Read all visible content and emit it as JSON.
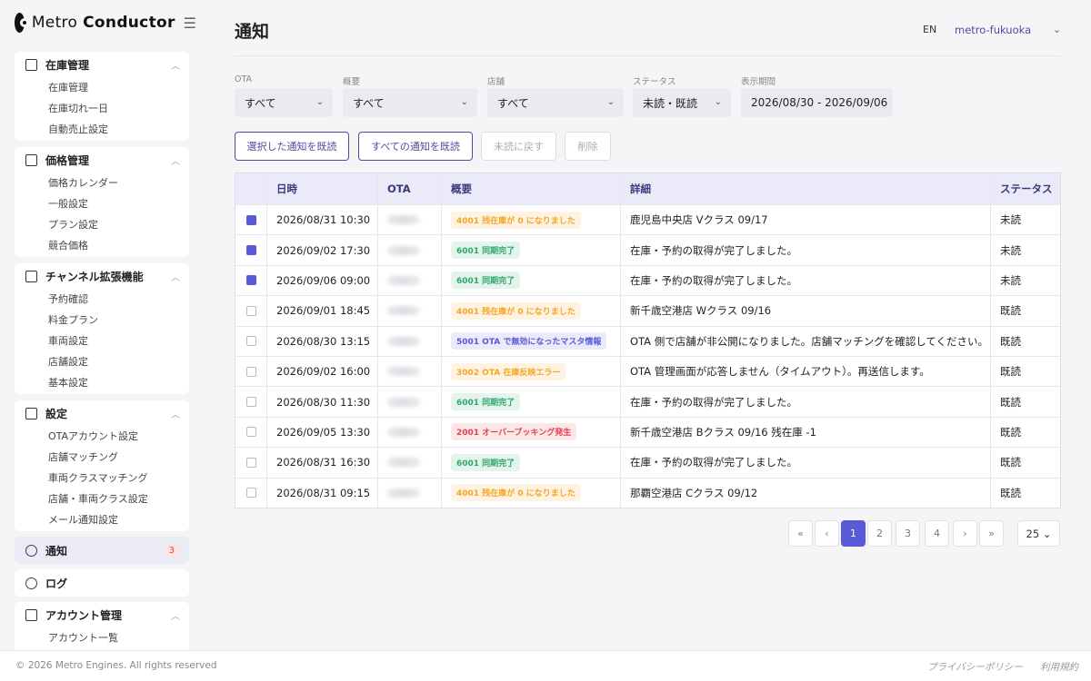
{
  "brand": {
    "name_light": "Metro",
    "name_bold": "Conductor"
  },
  "sidebar": {
    "sections": [
      {
        "title": "在庫管理",
        "items": [
          "在庫管理",
          "在庫切れ一日",
          "自動売止設定"
        ]
      },
      {
        "title": "価格管理",
        "items": [
          "価格カレンダー",
          "一般設定",
          "プラン設定",
          "競合価格"
        ]
      },
      {
        "title": "チャンネル拡張機能",
        "items": [
          "予約確認",
          "料金プラン",
          "車両設定",
          "店舗設定",
          "基本設定"
        ]
      },
      {
        "title": "設定",
        "items": [
          "OTAアカウント設定",
          "店舗マッチング",
          "車両クラスマッチング",
          "店舗・車両クラス設定",
          "メール通知設定"
        ]
      }
    ],
    "notifications": {
      "label": "通知",
      "count": "3"
    },
    "log": {
      "label": "ログ"
    },
    "account": {
      "title": "アカウント管理",
      "items": [
        "アカウント一覧"
      ]
    }
  },
  "header": {
    "title": "通知",
    "lang": "EN",
    "user": "metro-fukuoka"
  },
  "filters": {
    "ota": {
      "label": "OTA",
      "value": "すべて"
    },
    "summary": {
      "label": "概要",
      "value": "すべて"
    },
    "store": {
      "label": "店舗",
      "value": "すべて"
    },
    "status": {
      "label": "ステータス",
      "value": "未読・既読"
    },
    "period": {
      "label": "表示期間",
      "value": "2026/08/30 - 2026/09/06"
    }
  },
  "actions": {
    "mark_selected": "選択した通知を既読",
    "mark_all": "すべての通知を既読",
    "mark_unread": "未読に戻す",
    "delete": "削除"
  },
  "table": {
    "headers": [
      "日時",
      "OTA",
      "概要",
      "詳細",
      "ステータス"
    ],
    "rows": [
      {
        "checked": true,
        "date": "2026/08/31 10:30",
        "tag": "4001 残在庫が 0 になりました",
        "tag_color": "#f5a623",
        "detail": "鹿児島中央店 Vクラス 09/17",
        "status": "未読"
      },
      {
        "checked": true,
        "date": "2026/09/02 17:30",
        "tag": "6001 同期完了",
        "tag_color": "#2fa86b",
        "detail": "在庫・予約の取得が完了しました。",
        "status": "未読"
      },
      {
        "checked": true,
        "date": "2026/09/06 09:00",
        "tag": "6001 同期完了",
        "tag_color": "#2fa86b",
        "detail": "在庫・予約の取得が完了しました。",
        "status": "未読"
      },
      {
        "checked": false,
        "date": "2026/09/01 18:45",
        "tag": "4001 残在庫が 0 になりました",
        "tag_color": "#f5a623",
        "detail": "新千歳空港店 Wクラス 09/16",
        "status": "既読"
      },
      {
        "checked": false,
        "date": "2026/08/30 13:15",
        "tag": "5001 OTA で無効になったマスタ情報",
        "tag_color": "#5a5ad6",
        "detail": "OTA 側で店舗が非公開になりました。店舗マッチングを確認してください。",
        "status": "既読"
      },
      {
        "checked": false,
        "date": "2026/09/02 16:00",
        "tag": "3002 OTA 在庫反映エラー",
        "tag_color": "#f5a623",
        "detail": "OTA 管理画面が応答しません（タイムアウト）。再送信します。",
        "status": "既読"
      },
      {
        "checked": false,
        "date": "2026/08/30 11:30",
        "tag": "6001 同期完了",
        "tag_color": "#2fa86b",
        "detail": "在庫・予約の取得が完了しました。",
        "status": "既読"
      },
      {
        "checked": false,
        "date": "2026/09/05 13:30",
        "tag": "2001 オーバーブッキング発生",
        "tag_color": "#e0434f",
        "detail": "新千歳空港店 Bクラス 09/16 残在庫 -1",
        "status": "既読"
      },
      {
        "checked": false,
        "date": "2026/08/31 16:30",
        "tag": "6001 同期完了",
        "tag_color": "#2fa86b",
        "detail": "在庫・予約の取得が完了しました。",
        "status": "既読"
      },
      {
        "checked": false,
        "date": "2026/08/31 09:15",
        "tag": "4001 残在庫が 0 になりました",
        "tag_color": "#f5a623",
        "detail": "那覇空港店 Cクラス 09/12",
        "status": "既読"
      }
    ]
  },
  "pagination": {
    "first": "«",
    "prev": "‹",
    "pages": [
      "1",
      "2",
      "3",
      "4"
    ],
    "current": "1",
    "next": "›",
    "last": "»",
    "page_size": "25 ⌄"
  },
  "footer": {
    "copyright": "© 2026 Metro Engines. All rights reserved",
    "privacy": "プライバシーポリシー",
    "terms": "利用規約"
  },
  "icons": {
    "logo": "metro-logo",
    "menu": "hamburger-icon",
    "expand": "chevron-up-icon",
    "dropdown": "chevron-down-icon"
  }
}
